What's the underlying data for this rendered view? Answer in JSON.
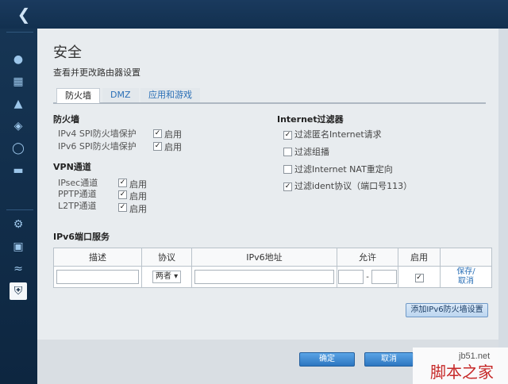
{
  "nav": {
    "back_icon": "chevron-left-icon"
  },
  "dialog": {
    "title": "安全",
    "subtitle": "查看并更改路由器设置",
    "tabs": [
      {
        "label": "防火墙",
        "active": true
      },
      {
        "label": "DMZ",
        "active": false
      },
      {
        "label": "应用和游戏",
        "active": false
      }
    ]
  },
  "firewall": {
    "heading": "防火墙",
    "items": [
      {
        "label": "IPv4 SPI防火墙保护",
        "checked": true,
        "check_label": "启用"
      },
      {
        "label": "IPv6 SPI防火墙保护",
        "checked": true,
        "check_label": "启用"
      }
    ]
  },
  "vpn": {
    "heading": "VPN通道",
    "items": [
      {
        "label": "IPsec通道",
        "checked": true,
        "check_label": "启用"
      },
      {
        "label": "PPTP通道",
        "checked": true,
        "check_label": "启用"
      },
      {
        "label": "L2TP通道",
        "checked": true,
        "check_label": "启用"
      }
    ]
  },
  "internet_filter": {
    "heading": "Internet过滤器",
    "items": [
      {
        "label": "过滤匿名Internet请求",
        "checked": true
      },
      {
        "label": "过滤组播",
        "checked": false
      },
      {
        "label": "过滤Internet NAT重定向",
        "checked": false
      },
      {
        "label": "过滤ident协议（端口号113）",
        "checked": true
      }
    ]
  },
  "ipv6_services": {
    "heading": "IPv6端口服务",
    "columns": [
      "描述",
      "协议",
      "IPv6地址",
      "允许",
      "启用",
      ""
    ],
    "row": {
      "protocol": "两者",
      "enabled": true,
      "save_label": "保存/",
      "cancel_label": "取消"
    },
    "add_button": "添加IPv6防火墙设置"
  },
  "footer": {
    "ok_label": "确定",
    "cancel_label": "取消"
  },
  "watermark": {
    "site": "jb51.net",
    "text": "脚本之家"
  }
}
